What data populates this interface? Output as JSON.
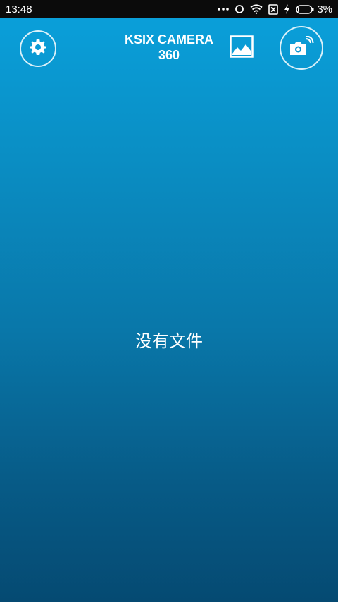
{
  "status_bar": {
    "time": "13:48",
    "battery_percent": "3%",
    "icons": [
      "more-dots-icon",
      "sync-circle-icon",
      "wifi-icon",
      "sim-off-icon",
      "charging-icon",
      "battery-icon"
    ]
  },
  "header": {
    "title_line1": "KSIX CAMERA",
    "title_line2": "360",
    "settings_icon": "gear-icon",
    "gallery_icon": "image-icon",
    "camera_icon": "camera-wifi-icon"
  },
  "main": {
    "empty_message": "没有文件"
  },
  "colors": {
    "gradient_top": "#0aa1dc",
    "gradient_bottom": "#054a72",
    "status_bar_bg": "#0b0b0b",
    "foreground": "#ffffff"
  }
}
